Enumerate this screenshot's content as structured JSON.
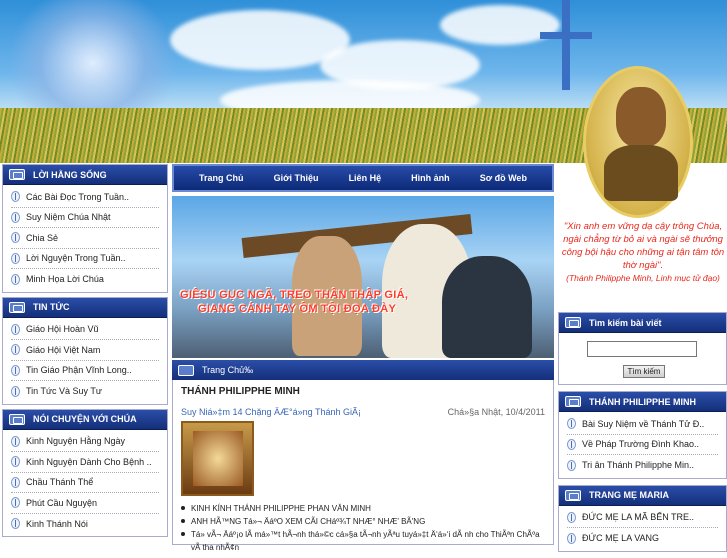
{
  "banner": {
    "quote": "\"Xin anh em vững dạ cậy trông Chúa, ngài chẳng từ bỏ ai và ngài sẽ thưởng công bội hậu cho những ai tận tâm tôn thờ ngài\".",
    "quote_source": "(Thánh Philipphe Minh, Linh mục tử đạo)"
  },
  "nav": [
    "Trang Chủ",
    "Giới Thiệu",
    "Liên Hệ",
    "Hình ảnh",
    "Sơ đồ Web"
  ],
  "hero": {
    "caption_line1": "GIÊSU GỤC NGÃ, TREO THÂN THẬP GIÁ,",
    "caption_line2": "GIANG CÁNH TAY ÔM TỘI ĐỌA ĐÀY"
  },
  "left": {
    "sections": [
      {
        "title": "LỜI HẰNG SỐNG",
        "items": [
          "Các Bài Đọc Trong Tuần..",
          "Suy Niệm Chúa Nhật",
          "Chia Sẻ",
          "Lời Nguyện Trong Tuần..",
          "Minh Họa Lời Chúa"
        ]
      },
      {
        "title": "TIN TỨC",
        "items": [
          "Giáo Hội Hoàn Vũ",
          "Giáo Hội Việt Nam",
          "Tin Giáo Phận Vĩnh Long..",
          "Tin Tức Và Suy Tư"
        ]
      },
      {
        "title": "NÓI CHUYỆN VỚI CHÚA",
        "items": [
          "Kinh Nguyện Hằng Ngày",
          "Kinh Nguyện Dành Cho Bệnh ..",
          "Chầu Thánh Thể",
          "Phút Cầu Nguyện",
          "Kinh Thánh Nói"
        ]
      }
    ]
  },
  "main": {
    "header": "Trang Chủ‰",
    "article_title": "THÁNH PHILIPPHE MINH",
    "subtitle": "Suy Niá»‡m 14 Chặng ÄÆ°á»ng Thánh GiÃ¡",
    "date": "Chá»§a Nhật, 10/4/2011",
    "bullets": [
      "KINH KÍNH THÁNH PHILIPPHE PHAN VĂN MINH",
      "ANH HÃ™NG Tá»¬ ÄáºO XEM CÃI CHáº¾T NHÆ° NHÆ' BÃ'NG",
      "Tá»­ vÃ¬ Äáº¡o lÃ  má»™t hÃ¬nh thá»©c cá»§a tÃ¬nh yÃªu tuyá»‡t Ä‘á»‘i dÃ nh cho ThiÃªn ChÃºa vÃ  tha nhÃ¢n"
    ]
  },
  "right": {
    "search": {
      "title": "Tìm kiếm bài viết",
      "button": "Tìm kiếm",
      "value": ""
    },
    "saint": {
      "title": "THÁNH PHILIPPHE MINH",
      "items": [
        "Bài Suy Niệm về Thánh Tử Đ..",
        "Về Pháp Trường Đình Khao..",
        "Tri ân Thánh Philipphe Min.."
      ]
    },
    "mary": {
      "title": "TRANG MẸ MARIA",
      "items": [
        "ĐỨC MẸ LA MÃ BẾN TRE..",
        "ĐỨC MẸ LA VANG"
      ]
    }
  }
}
